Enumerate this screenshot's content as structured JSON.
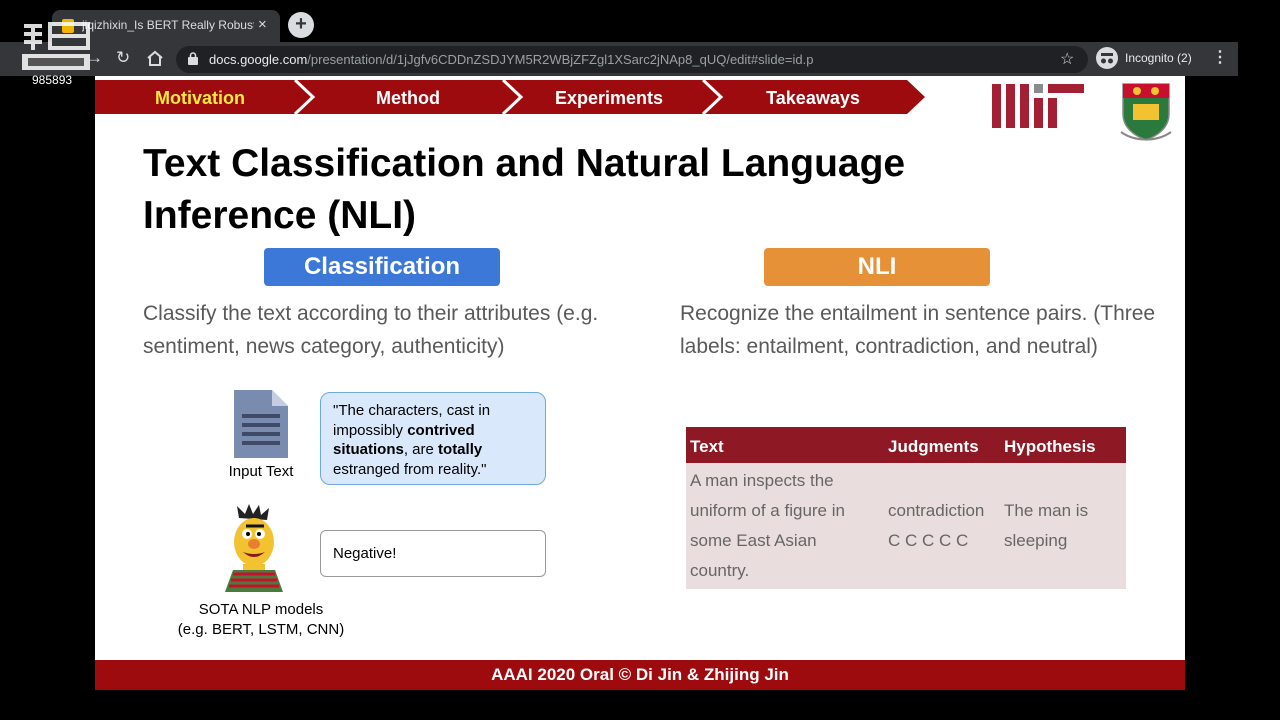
{
  "browser": {
    "tab_title": "jiqizhixin_Is BERT Really Robust?",
    "tab_close": "×",
    "new_tab": "+",
    "url_host": "docs.google.com",
    "url_rest": "/presentation/d/1jJgfv6CDDnZSDJYM5R2WBjZFZgl1XSarc2jNAp8_qUQ/edit#slide=id.p",
    "incognito_label": "Incognito (2)",
    "icons": [
      "back-icon",
      "forward-icon",
      "reload-icon",
      "home-icon",
      "lock-icon",
      "star-icon",
      "incognito-icon",
      "menu-icon"
    ]
  },
  "watermark": {
    "number": "985893"
  },
  "slide": {
    "nav": {
      "items": [
        "Motivation",
        "Method",
        "Experiments",
        "Takeaways"
      ],
      "active": "Motivation",
      "active_color": "#ffeb3b",
      "banner_color": "#9e0b0f"
    },
    "title": "Text Classification and Natural Language Inference (NLI)",
    "classification": {
      "badge": "Classification",
      "badge_color": "#3c78d8",
      "description": "Classify the text according to their attributes (e.g. sentiment, news category, authenticity)",
      "input_label": "Input Text",
      "quote_parts": [
        {
          "text": "\"The characters, cast in impossibly ",
          "bold": false
        },
        {
          "text": "contrived situations",
          "bold": true
        },
        {
          "text": ", are ",
          "bold": false
        },
        {
          "text": "totally",
          "bold": true
        },
        {
          "text": " estranged from reality.\"",
          "bold": false
        }
      ],
      "output": "Negative!",
      "model_label_line1": "SOTA NLP models",
      "model_label_line2": "(e.g. BERT, LSTM, CNN)"
    },
    "nli": {
      "badge": "NLI",
      "badge_color": "#e69138",
      "description": "Recognize the entailment in sentence pairs. (Three labels: entailment, contradiction, and neutral)",
      "table": {
        "headers": [
          "Text",
          "Judgments",
          "Hypothesis"
        ],
        "text": "A man inspects the uniform of a figure in some East Asian country.",
        "judgment_line1": "contradiction",
        "judgment_line2": "C C C C C",
        "hypothesis": "The man is sleeping"
      }
    },
    "footer": "AAAI 2020 Oral © Di Jin & Zhijing Jin"
  }
}
